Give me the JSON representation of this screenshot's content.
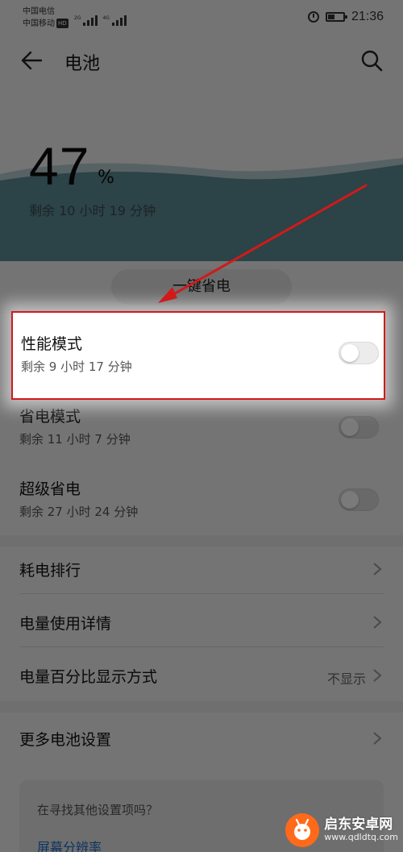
{
  "status_bar": {
    "carrier_1": "中国电信",
    "carrier_2": "中国移动",
    "carrier_2_badge": "HD",
    "sig_1_tag": "2G",
    "sig_2_tag": "4G",
    "battery_level": 0.47,
    "time": "21:36"
  },
  "header": {
    "title": "电池",
    "back_icon": "arrow-left-icon",
    "search_icon": "search-icon"
  },
  "battery": {
    "percent": "47",
    "unit": "%",
    "remaining": "剩余 10 小时 19 分钟",
    "wave_color": "#5c8c95"
  },
  "one_key_button": {
    "label": "一键省电"
  },
  "modes": [
    {
      "title": "性能模式",
      "subtitle": "剩余 9 小时 17 分钟",
      "enabled": false
    },
    {
      "title": "省电模式",
      "subtitle": "剩余 11 小时 7 分钟",
      "enabled": false
    },
    {
      "title": "超级省电",
      "subtitle": "剩余 27 小时 24 分钟",
      "enabled": false
    }
  ],
  "list": [
    {
      "label": "耗电排行"
    },
    {
      "label": "电量使用详情"
    },
    {
      "label": "电量百分比显示方式",
      "value": "不显示"
    },
    {
      "label": "更多电池设置"
    }
  ],
  "suggest": {
    "question": "在寻找其他设置项吗？",
    "link": "屏幕分辨率"
  },
  "annotation": {
    "highlight_color": "#d11a1a"
  },
  "watermark": {
    "name": "启东安卓网",
    "url": "www.qdldtq.com"
  }
}
